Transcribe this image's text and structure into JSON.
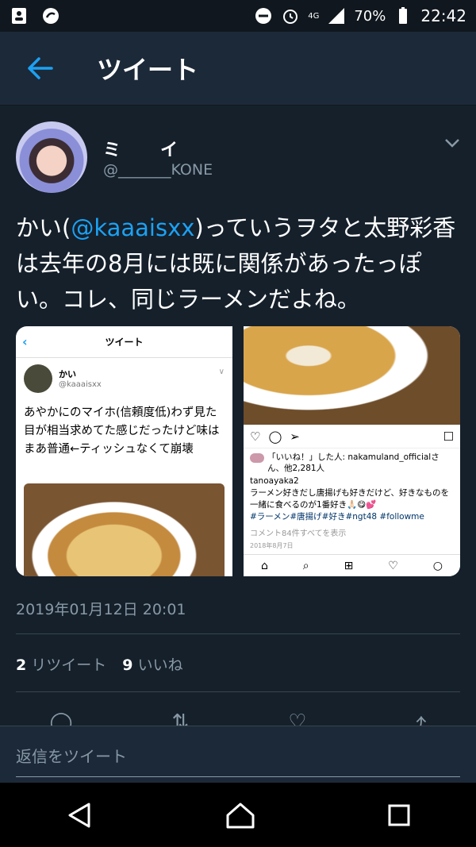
{
  "status_bar": {
    "network": "4G",
    "battery": "70%",
    "time": "22:42"
  },
  "header": {
    "title": "ツイート"
  },
  "tweet": {
    "author_name": "ミイ",
    "author_handle": "@_______KONE",
    "text_before": "かい(",
    "mention": "@kaaaisxx",
    "text_after": ")っていうヲタと太野彩香は去年の8月には既に関係があったっぽい。コレ、同じラーメンだよね。",
    "timestamp": "2019年01月12日 20:01",
    "retweet_count": "2",
    "retweet_label": "リツイート",
    "like_count": "9",
    "like_label": "いいね"
  },
  "media_left": {
    "bar_title": "ツイート",
    "user_name": "かい",
    "user_handle": "@kaaaisxx",
    "text": "あやかにのマイホ(信頼度低)わず見た目が相当求めてた感じだったけど味はまあ普通←ティッシュなくて崩壊"
  },
  "media_right": {
    "liked_by": "「いいね！」した人: nakamuland_officialさん、他2,281人",
    "caption_user": "tanoayaka2",
    "caption_text": "ラーメン好きだし唐揚げも好きだけど、好きなものを一緒に食べるのが1番好き🙏🏻😋💕",
    "hashtags": "#ラーメン#唐揚げ#好き#ngt48 #followme",
    "comments": "コメント84件すべてを表示",
    "date": "2018年8月7日"
  },
  "reply": {
    "placeholder": "返信をツイート"
  },
  "colors": {
    "background": "#15202b",
    "accent": "#1da1f2",
    "muted": "#8899a6"
  }
}
